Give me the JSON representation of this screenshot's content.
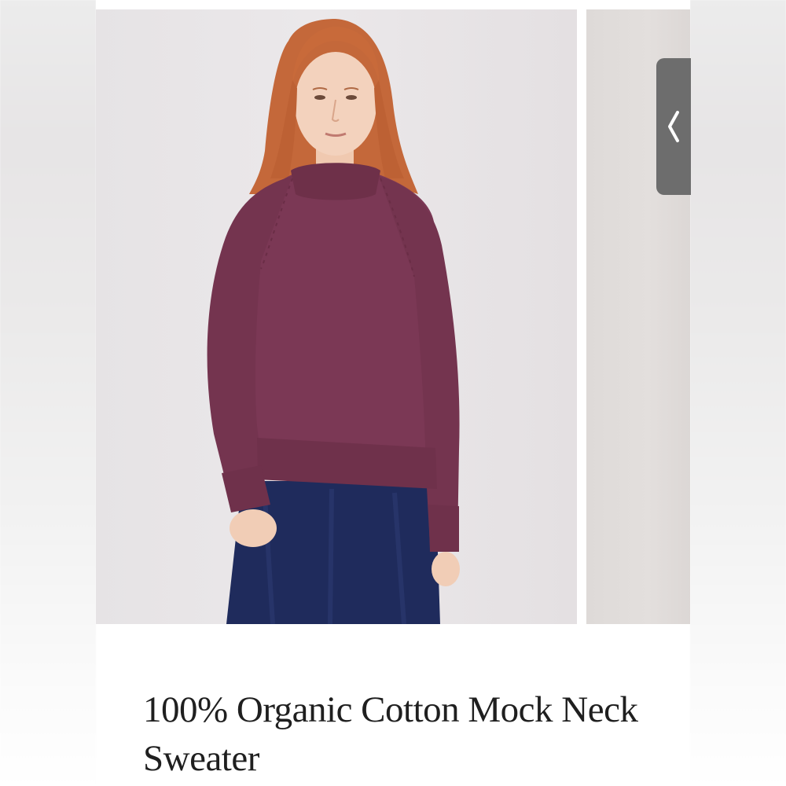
{
  "product": {
    "title": "100% Organic Cotton Mock Neck Sweater"
  },
  "gallery": {
    "prev_icon": "chevron-left-icon"
  },
  "colors": {
    "sweater": "#7b3855",
    "skirt": "#1f2b5c",
    "hair": "#c86a3a",
    "background": "#e8e5e7",
    "nav_button": "#6d6d6d"
  }
}
